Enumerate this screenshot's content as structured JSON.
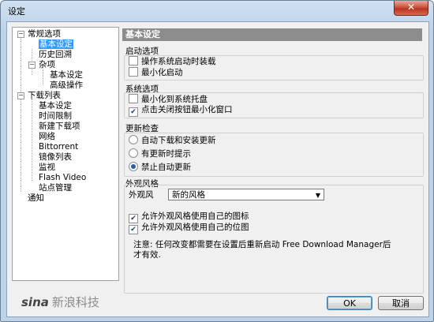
{
  "window": {
    "title": "设定",
    "close_glyph": "✕"
  },
  "tree": {
    "items": [
      {
        "label": "常规选项"
      },
      {
        "label": "基本设定"
      },
      {
        "label": "历史回溯"
      },
      {
        "label": "杂项"
      },
      {
        "label": "基本设定"
      },
      {
        "label": "高级操作"
      },
      {
        "label": "下载列表"
      },
      {
        "label": "基本设定"
      },
      {
        "label": "时间限制"
      },
      {
        "label": "新建下载项"
      },
      {
        "label": "网络"
      },
      {
        "label": "Bittorrent"
      },
      {
        "label": "镜像列表"
      },
      {
        "label": "监视"
      },
      {
        "label": "Flash Video"
      },
      {
        "label": "站点管理"
      },
      {
        "label": "通知"
      }
    ]
  },
  "panel": {
    "title": "基本设定",
    "startup": {
      "title": "启动选项",
      "opt1": "操作系统启动时装载",
      "opt2": "最小化启动"
    },
    "tray": {
      "title": "系统选项",
      "opt1": "最小化到系统托盘",
      "opt2": "点击关闭按钮最小化窗口"
    },
    "update": {
      "title": "更新检查",
      "opt1": "自动下载和安装更新",
      "opt2": "有更新时提示",
      "opt3": "禁止自动更新"
    },
    "skin": {
      "title": "外观风格",
      "label": "外观风",
      "selected": "新的风格",
      "opt1": "允许外观风格使用自己的图标",
      "opt2": "允许外观风格使用自己的位图"
    },
    "note": "注意: 任何改变都需要在设置后重新启动 Free Download Manager后才有效."
  },
  "buttons": {
    "ok": "OK",
    "cancel": "取消"
  },
  "watermark": {
    "mark": "sina",
    "text": "新浪科技"
  }
}
